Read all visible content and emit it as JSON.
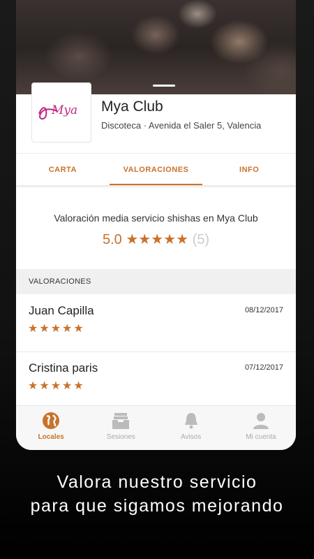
{
  "venue": {
    "name": "Mya Club",
    "logo_text": "Mya",
    "address": "Discoteca · Avenida el Saler 5, Valencia"
  },
  "tabs": [
    {
      "label": "CARTA",
      "active": false
    },
    {
      "label": "VALORACIONES",
      "active": true
    },
    {
      "label": "INFO",
      "active": false
    }
  ],
  "rating_summary": {
    "title": "Valoración media servicio shishas en Mya Club",
    "average": "5.0",
    "stars": "★★★★★",
    "count": "(5)"
  },
  "reviews_header": "VALORACIONES",
  "reviews": [
    {
      "name": "Juan Capilla",
      "date": "08/12/2017",
      "stars": "★★★★★"
    },
    {
      "name": "Cristina paris",
      "date": "07/12/2017",
      "stars": "★★★★★"
    }
  ],
  "bottom_nav": [
    {
      "label": "Locales",
      "icon": "globe-icon",
      "active": true
    },
    {
      "label": "Sesiones",
      "icon": "inbox-icon",
      "active": false
    },
    {
      "label": "Avisos",
      "icon": "bell-icon",
      "active": false
    },
    {
      "label": "Mi cuenta",
      "icon": "user-icon",
      "active": false
    }
  ],
  "caption": {
    "line1": "Valora nuestro servicio",
    "line2": "para que sigamos mejorando"
  },
  "colors": {
    "accent": "#c9722a",
    "logo_pink": "#c2267f"
  }
}
